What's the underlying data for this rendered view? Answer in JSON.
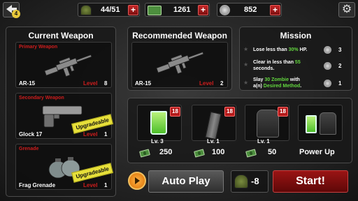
{
  "top_bar": {
    "back_badge": "4",
    "energy": "44/51",
    "cash": "1261",
    "medals": "852",
    "plus": "+"
  },
  "current_weapon": {
    "title": "Current Weapon",
    "level_label": "Level",
    "primary": {
      "slot": "Primary Weapon",
      "name": "AR-15",
      "level": "8"
    },
    "secondary": {
      "slot": "Secondary Weapon",
      "name": "Glock 17",
      "level": "1",
      "tag": "Upgradeable"
    },
    "grenade": {
      "slot": "Grenade",
      "name": "Frag Grenade",
      "level": "1",
      "tag": "Upgradeable"
    }
  },
  "recommended_weapon": {
    "title": "Recommended Weapon",
    "name": "AR-15",
    "level_label": "Level",
    "level": "2"
  },
  "mission": {
    "title": "Mission",
    "items": [
      {
        "pre": "Lose less than ",
        "highlight": "30%",
        "post": " HP.",
        "reward": "3"
      },
      {
        "pre": "Clear in less than ",
        "highlight": "55",
        "post": "",
        "line2": "seconds.",
        "reward": "2"
      },
      {
        "pre": "Slay ",
        "highlight": "30 Zombie",
        "post": " with",
        "line2_pre": "a(n) ",
        "line2_highlight": "Desired Method",
        "line2_post": ".",
        "reward": "1"
      }
    ]
  },
  "shop": {
    "items": [
      {
        "count": "18",
        "level": "Lv.  3",
        "price": "250"
      },
      {
        "count": "18",
        "level": "Lv.  1",
        "price": "100"
      },
      {
        "count": "18",
        "level": "Lv.  1",
        "price": "50"
      },
      {
        "label": "Power Up"
      }
    ]
  },
  "bottom": {
    "auto_play": "Auto Play",
    "energy_cost": "-8",
    "start": "Start!"
  },
  "colors": {
    "accent_red": "#d01d1d",
    "highlight_green": "#63d73f",
    "sticker_yellow": "#e7e03a"
  }
}
